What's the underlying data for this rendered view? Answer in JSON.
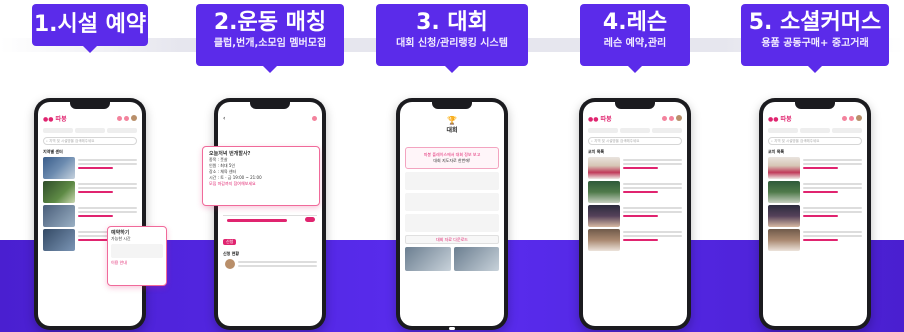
{
  "steps": [
    {
      "title": "1.시설 예약",
      "subtitle": ""
    },
    {
      "title": "2.운동 매칭",
      "subtitle": "클럽,번개,소모임 멤버모집"
    },
    {
      "title": "3. 대회",
      "subtitle": "대회 신청/관리랭킹 시스템"
    },
    {
      "title": "4.레슨",
      "subtitle": "레슨 예약,관리"
    },
    {
      "title": "5. 소셜커머스",
      "subtitle": "용품 공동구매+ 중고거래"
    }
  ],
  "app": {
    "logo": "●● 따봉",
    "search_placeholder": "지역 및 시설명을 검색해주세요",
    "facility_section": "지역별 센터",
    "lesson_section": "코치 목록",
    "tournament_label": "대회",
    "tournament_notice": "따봉 플레이스에서 대회 정보 보고",
    "tournament_notice2": "대회 지도자로 한번에!",
    "bracket_button": "대회 자료 다운로드",
    "reserve_popup": [
      "예약하기",
      "가능한 시간",
      "이용 안내"
    ],
    "meet_popup": {
      "title": "오늘저녁 번개할사?",
      "lines": [
        "종목 : 풋살",
        "인원 : 최대 5인",
        "장소 : 체육 센터",
        "시간 : 토 · 금 19:00 ~ 21:00"
      ],
      "cta": "모집 마감까지 참여해보세요"
    },
    "chart_label": "매칭 현황",
    "chart_button": "신청",
    "chat_label": "신청 현황"
  },
  "colors": {
    "accent": "#5b2bea",
    "brand": "#e0246f",
    "band": "#4a1fd0"
  }
}
